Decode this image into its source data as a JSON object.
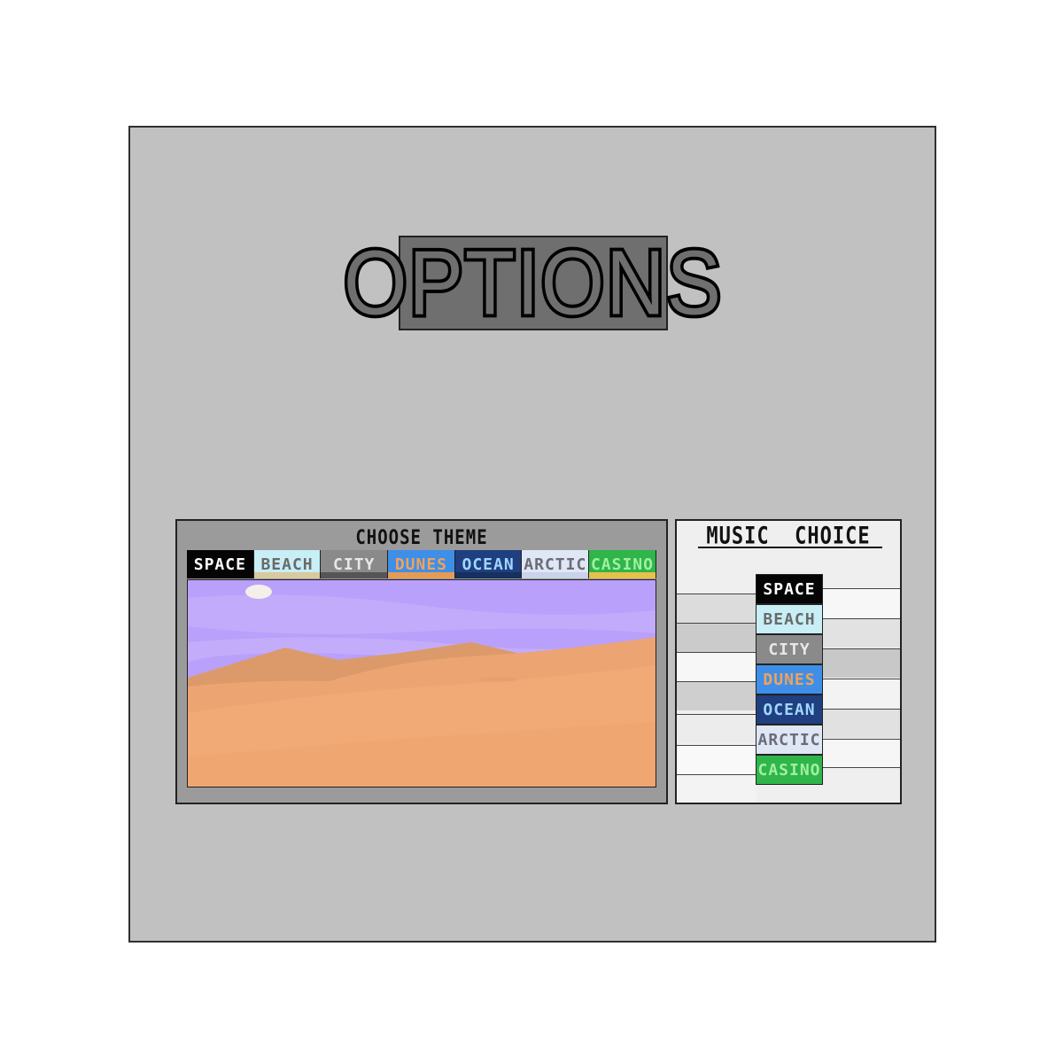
{
  "title": "OPTIONS",
  "theme_panel": {
    "heading": "CHOOSE THEME",
    "themes": [
      {
        "label": "SPACE",
        "bg": "#050505",
        "fg": "#ffffff",
        "bottom": "#050505"
      },
      {
        "label": "BEACH",
        "bg": "#c8eef6",
        "fg": "#6a6a6a",
        "bottom": "#d9c9a0"
      },
      {
        "label": "CITY",
        "bg": "#8a8a8a",
        "fg": "#e8e8e8",
        "bottom": "#555555"
      },
      {
        "label": "DUNES",
        "bg": "#3f8fe8",
        "fg": "#f0a25a",
        "bottom": "#e59a55"
      },
      {
        "label": "OCEAN",
        "bg": "#1f3f80",
        "fg": "#9fd6ff",
        "bottom": "#16305f"
      },
      {
        "label": "ARCTIC",
        "bg": "#dfe6f4",
        "fg": "#6b6b7a",
        "bottom": "#c9d3ea"
      },
      {
        "label": "CASINO",
        "bg": "#2fb54a",
        "fg": "#9ff0a0",
        "bottom": "#e6c24a"
      }
    ],
    "selected": "DUNES"
  },
  "music_panel": {
    "heading": "MUSIC  CHOICE",
    "tracks": [
      {
        "label": "SPACE",
        "bg": "#050505",
        "fg": "#ffffff"
      },
      {
        "label": "BEACH",
        "bg": "#c8eef6",
        "fg": "#6a6a6a"
      },
      {
        "label": "CITY",
        "bg": "#8a8a8a",
        "fg": "#e8e8e8"
      },
      {
        "label": "DUNES",
        "bg": "#3f8fe8",
        "fg": "#f0a25a"
      },
      {
        "label": "OCEAN",
        "bg": "#1f3f80",
        "fg": "#9fd6ff"
      },
      {
        "label": "ARCTIC",
        "bg": "#dfe6f4",
        "fg": "#6b6b7a"
      },
      {
        "label": "CASINO",
        "bg": "#2fb54a",
        "fg": "#9ff0a0"
      }
    ]
  },
  "colors": {
    "panel": "#c1c1c1",
    "sky": "#b9a0fa",
    "sand": "#f1aa76",
    "sun": "#f4efe8"
  }
}
